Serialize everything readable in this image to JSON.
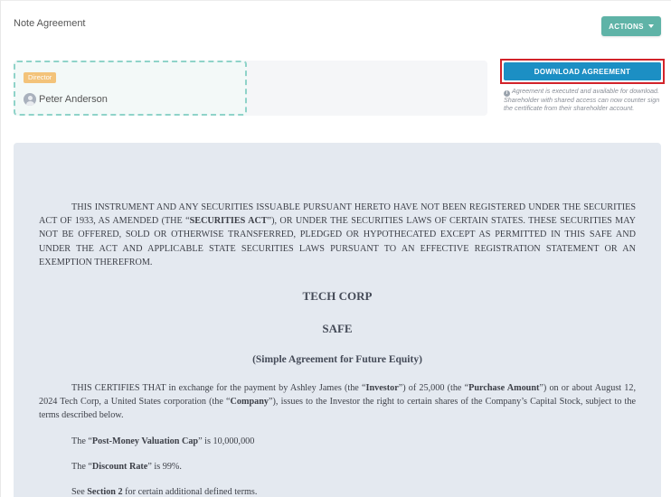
{
  "header": {
    "title": "Note Agreement",
    "actions_label": "ACTIONS"
  },
  "signer": {
    "role": "Director",
    "name": "Peter Anderson"
  },
  "download": {
    "label": "DOWNLOAD AGREEMENT",
    "info": "Agreement is executed and available for download. Shareholder with shared access can now counter sign the certificate from their shareholder account."
  },
  "document": {
    "legend": {
      "part1": "THIS INSTRUMENT AND ANY SECURITIES ISSUABLE PURSUANT HERETO HAVE NOT BEEN REGISTERED UNDER THE SECURITIES ACT OF 1933, AS AMENDED (THE “",
      "bold1": "SECURITIES ACT",
      "part2": "”), OR UNDER THE SECURITIES LAWS OF CERTAIN STATES. THESE SECURITIES MAY NOT BE OFFERED, SOLD OR OTHERWISE TRANSFERRED, PLEDGED OR HYPOTHECATED EXCEPT AS PERMITTED IN THIS SAFE AND UNDER THE ACT AND APPLICABLE STATE SECURITIES LAWS PURSUANT TO AN EFFECTIVE REGISTRATION STATEMENT OR AN EXEMPTION THEREFROM."
    },
    "company": "TECH CORP",
    "instrument": "SAFE",
    "subtitle": "(Simple Agreement for Future Equity)",
    "certifies": {
      "t1": "THIS CERTIFIES THAT in exchange for the payment by Ashley James (the “",
      "b1": "Investor",
      "t2": "”) of 25,000 (the “",
      "b2": "Purchase Amount",
      "t3": "”) on or about August 12, 2024 Tech Corp, a United States corporation (the “",
      "b3": "Company",
      "t4": "”), issues to the Investor the right to certain shares of the Company’s Capital Stock, subject to the terms described below."
    },
    "valuation": {
      "t1": "The “",
      "b1": "Post-Money Valuation Cap",
      "t2": "” is 10,000,000"
    },
    "discount": {
      "t1": "The “",
      "b1": "Discount Rate",
      "t2": "” is 99%."
    },
    "see_section": {
      "t1": "See ",
      "b1": "Section 2",
      "t2": " for certain additional defined terms."
    }
  }
}
